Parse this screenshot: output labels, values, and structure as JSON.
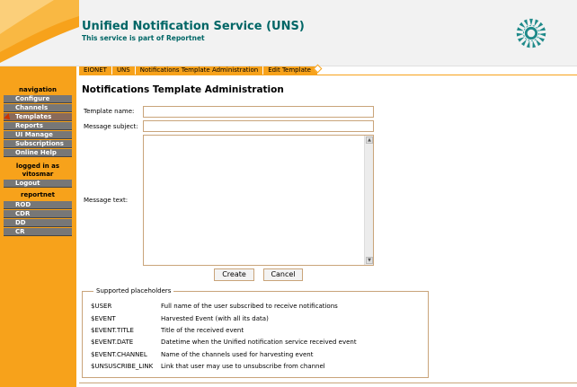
{
  "header": {
    "title": "Unified Notification Service (UNS)",
    "subtitle": "This service is part of Reportnet"
  },
  "breadcrumbs": [
    "EIONET",
    "UNS",
    "Notifications Template Administration",
    "Edit Template"
  ],
  "nav": {
    "heading": "navigation",
    "items": [
      "Configure",
      "Channels",
      "Templates",
      "Reports",
      "UI Manage",
      "Subscriptions",
      "Online Help"
    ],
    "active": "Templates",
    "logged_in_label": "logged in as",
    "username": "vitosmar",
    "logout": "Logout",
    "reportnet_heading": "reportnet",
    "reportnet_items": [
      "ROD",
      "CDR",
      "DD",
      "CR"
    ]
  },
  "page": {
    "title": "Notifications Template Administration"
  },
  "form": {
    "template_name_label": "Template name:",
    "template_name_value": "",
    "message_subject_label": "Message subject:",
    "message_subject_value": "",
    "message_text_label": "Message text:",
    "message_text_value": "",
    "create_label": "Create",
    "cancel_label": "Cancel"
  },
  "placeholders": {
    "legend": "Supported placeholders",
    "rows": [
      {
        "key": "$USER",
        "desc": "Full name of the user subscribed to receive notifications"
      },
      {
        "key": "$EVENT",
        "desc": "Harvested Event (with all its data)"
      },
      {
        "key": "$EVENT.TITLE",
        "desc": "Title of the received event"
      },
      {
        "key": "$EVENT.DATE",
        "desc": "Datetime when the Unified notification service received event"
      },
      {
        "key": "$EVENT.CHANNEL",
        "desc": "Name of the channels used for harvesting event"
      },
      {
        "key": "$UNSUSCRIBE_LINK",
        "desc": "Link that user may use to unsubscribe from channel"
      }
    ]
  },
  "colors": {
    "accent_orange": "#f7a21b",
    "title_teal": "#006666",
    "nav_button_gray": "#777777",
    "field_border": "#c9a47a"
  },
  "icons": {
    "logo": "eionet-sunflower-logo",
    "active_marker": "active-item-arrow-icon"
  }
}
